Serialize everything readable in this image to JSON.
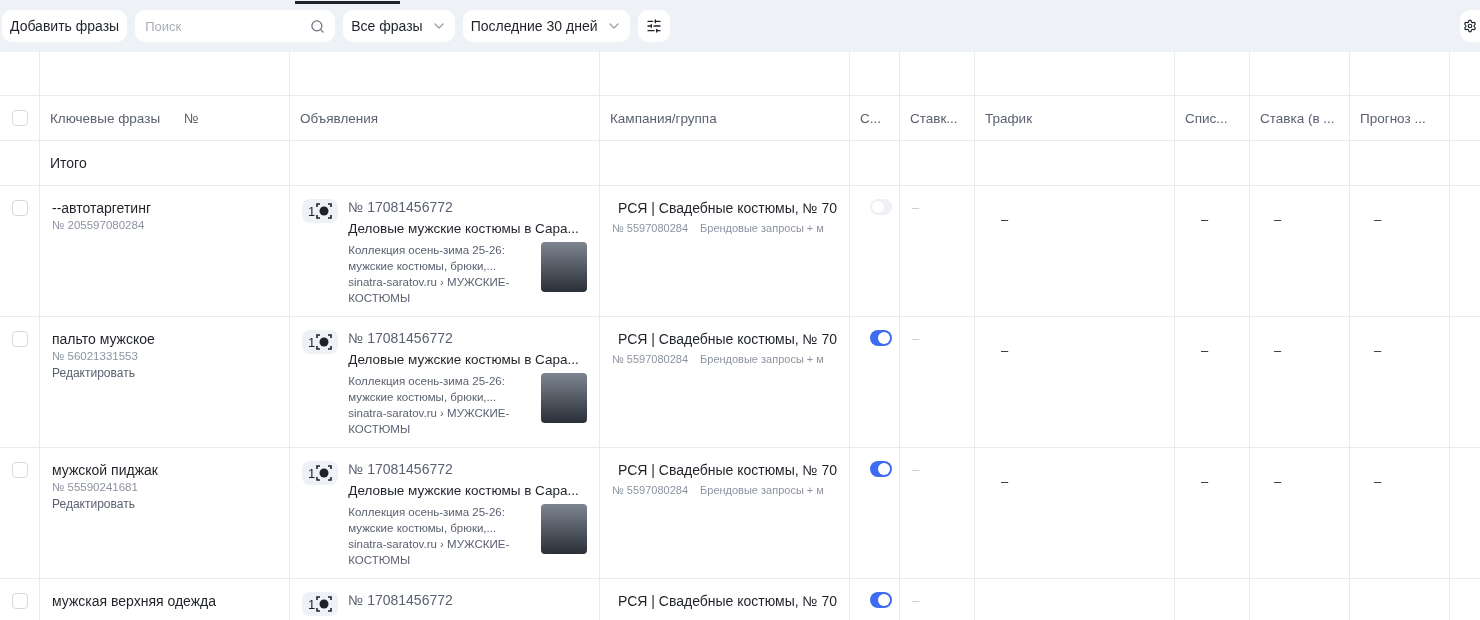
{
  "toolbar": {
    "add_button": "Добавить фразы",
    "search": {
      "placeholder": "Поиск"
    },
    "filter": "Все фразы",
    "period": "Последние 30 дней"
  },
  "table": {
    "select_all_checked": false,
    "keyword_column": "Ключевые фразы",
    "number_column": "№",
    "columns": [
      "Объявления",
      "Кампания/группа",
      "С...",
      "Ставк...",
      "Трафик",
      "Спис...",
      "Ставка (в ...",
      "Прогноз ..."
    ],
    "total_label": "Итого",
    "rows": [
      {
        "checked": false,
        "keyword": "--автотаргетинг",
        "number": "№ 205597080284",
        "ad": {
          "count": "1",
          "number": "№ 17081456772",
          "title": "Деловые мужские костюмы в Сара...",
          "text": "Коллекция осень-зима 25-26: мужские костюмы, брюки,...",
          "url": "sinatra-saratov.ru › МУЖСКИЕ-КОСТЮМЫ"
        },
        "campaign": {
          "name": "РСЯ | Свадебные костюмы, № 70",
          "number": "№ 5597080284",
          "group": "Брендовые запросы + м"
        },
        "on": false,
        "bid": "–",
        "traffic": "–",
        "spend": "–",
        "bid_net": "–",
        "forecast": "–"
      },
      {
        "checked": false,
        "keyword": "пальто мужское",
        "number": "№ 56021331553",
        "edit_link": "Редактировать",
        "ad": {
          "count": "1",
          "number": "№ 17081456772",
          "title": "Деловые мужские костюмы в Сара...",
          "text": "Коллекция осень-зима 25-26: мужские костюмы, брюки,...",
          "url": "sinatra-saratov.ru › МУЖСКИЕ-КОСТЮМЫ"
        },
        "campaign": {
          "name": "РСЯ | Свадебные костюмы, № 70",
          "number": "№ 5597080284",
          "group": "Брендовые запросы + м"
        },
        "on": true,
        "bid": "–",
        "traffic": "–",
        "spend": "–",
        "bid_net": "–",
        "forecast": "–"
      },
      {
        "checked": false,
        "keyword": "мужской пиджак",
        "number": "№ 55590241681",
        "edit_link": "Редактировать",
        "ad": {
          "count": "1",
          "number": "№ 17081456772",
          "title": "Деловые мужские костюмы в Сара...",
          "text": "Коллекция осень-зима 25-26: мужские костюмы, брюки,...",
          "url": "sinatra-saratov.ru › МУЖСКИЕ-КОСТЮМЫ"
        },
        "campaign": {
          "name": "РСЯ | Свадебные костюмы, № 70",
          "number": "№ 5597080284",
          "group": "Брендовые запросы + м"
        },
        "on": true,
        "bid": "–",
        "traffic": "–",
        "spend": "–",
        "bid_net": "–",
        "forecast": "–"
      },
      {
        "checked": false,
        "keyword": "мужская верхняя одежда",
        "ad": {
          "count": "1",
          "number": "№ 17081456772"
        },
        "campaign": {
          "name": "РСЯ | Свадебные костюмы, № 70"
        },
        "on": true,
        "bid": "–"
      }
    ]
  }
}
